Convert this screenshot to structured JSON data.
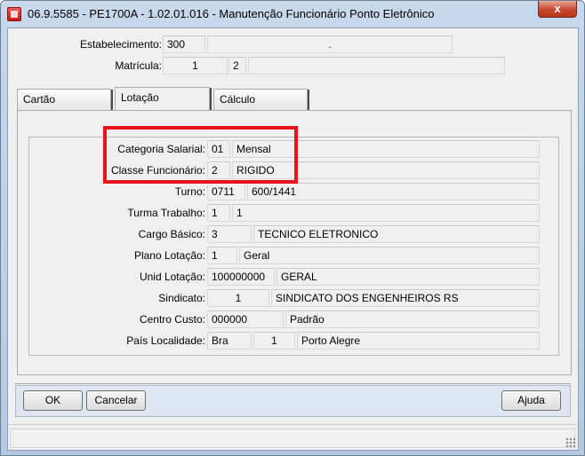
{
  "window": {
    "title": "06.9.5585 - PE1700A - 1.02.01.016 - Manutenção Funcionário Ponto Eletrônico",
    "close_glyph": "x"
  },
  "header": {
    "estabelecimento": {
      "label": "Estabelecimento:",
      "code": "300",
      "desc": "."
    },
    "matricula": {
      "label": "Matrícula:",
      "value1": "1",
      "value2": "2",
      "value3": ""
    }
  },
  "tabs": [
    {
      "label": "Cartão",
      "active": false
    },
    {
      "label": "Lotação",
      "active": true
    },
    {
      "label": "Cálculo",
      "active": false
    }
  ],
  "fields": {
    "categoria_salarial": {
      "label": "Categoria Salarial:",
      "code": "01",
      "desc": "Mensal"
    },
    "classe_funcionario": {
      "label": "Classe Funcionário:",
      "code": "2",
      "desc": "RIGIDO"
    },
    "turno": {
      "label": "Turno:",
      "code": "0711",
      "desc": "600/1441"
    },
    "turma_trabalho": {
      "label": "Turma Trabalho:",
      "code": "1",
      "desc": "1"
    },
    "cargo_basico": {
      "label": "Cargo Básico:",
      "code": "3",
      "desc": "TECNICO ELETRONICO"
    },
    "plano_lotacao": {
      "label": "Plano Lotação:",
      "code": "1",
      "desc": "Geral"
    },
    "unid_lotacao": {
      "label": "Unid Lotação:",
      "code": "100000000",
      "desc": "GERAL"
    },
    "sindicato": {
      "label": "Sindicato:",
      "code": "1",
      "desc": "SINDICATO DOS ENGENHEIROS RS"
    },
    "centro_custo": {
      "label": "Centro Custo:",
      "code": "000000",
      "desc": "Padrão"
    },
    "pais_localidade": {
      "label": "País Localidade:",
      "code": "Bra",
      "mid": "1",
      "desc": "Porto Alegre"
    }
  },
  "buttons": {
    "ok": "OK",
    "cancel": "Cancelar",
    "help": "Ajuda"
  },
  "colors": {
    "highlight": "#e8141b",
    "title_bar": "#b4c9e1"
  }
}
